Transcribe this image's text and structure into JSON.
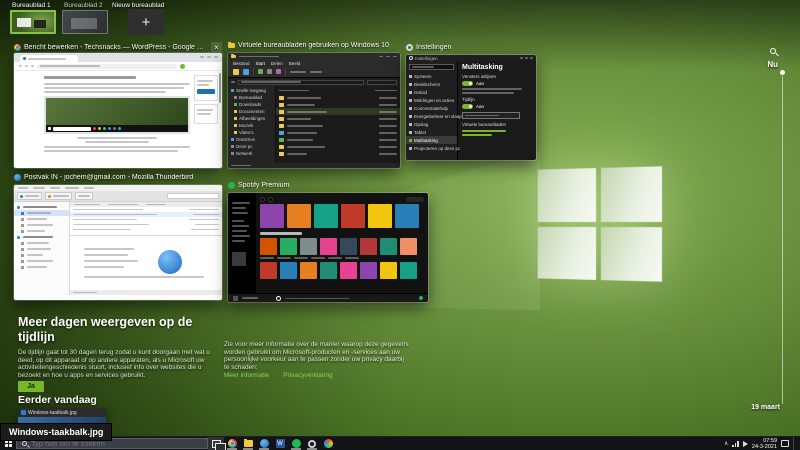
{
  "accent": {
    "green": "#76b82a",
    "link_green": "#8bd34f"
  },
  "task_view": {
    "desktops": [
      {
        "label": "Bureaublad 1"
      },
      {
        "label": "Bureaublad 2"
      }
    ],
    "new_desktop_label": "Nieuw bureaublad",
    "new_desktop_glyph": "+",
    "now_label": "Nu",
    "oldest_date_label": "19 maart"
  },
  "windows": {
    "chrome": {
      "title": "Bericht bewerken - Techsnacks — WordPress - Google Chrome",
      "close_glyph": "×"
    },
    "explorer": {
      "title": "Virtuele bureaubladen gebruiken op Windows 10",
      "tabs": [
        "Bestand",
        "Start",
        "Delen",
        "Beeld"
      ],
      "nav": [
        "Snelle toegang",
        "Bureaublad",
        "Downloads",
        "Documenten",
        "Afbeeldingen",
        "Muziek",
        "Video's",
        "OneDrive",
        "Deze pc",
        "Netwerk"
      ]
    },
    "settings": {
      "title": "Instellingen",
      "nav": [
        "Systeem",
        "Beeldscherm",
        "Geluid",
        "Meldingen en acties",
        "Concentratiehulp",
        "Energiebeheer en slaapstand",
        "Opslag",
        "Tablet",
        "Multitasking",
        "Projecteren op deze pc"
      ],
      "panel_title": "Multitasking",
      "sections": [
        "Vensters uitlijnen",
        "Tijdlijn",
        "Virtuele bureaubladen"
      ],
      "toggle_on": "Aan"
    },
    "thunderbird": {
      "title": "Postvak IN - jochem@gmail.com - Mozilla Thunderbird"
    },
    "spotify": {
      "title": "Spotify Premium"
    }
  },
  "timeline": {
    "heading": "Meer dagen weergeven op de tijdlijn",
    "paragraph_left": "De tijdlijn gaat tot 30 dagen terug zodat u kunt doorgaan met wat u deed, op dit apparaat of op andere apparaten, als u Microsoft uw activiteitengeschiedenis stuurt, inclusief info over websites die u bezoekt en hoe u apps en services gebruikt.",
    "paragraph_right": "Zie voor meer informatie over de manier waarop deze gegevens worden gebruikt om Microsoft-producten en -services aan uw persoonlijke voorkeur aan te passen zonder uw privacy daarbij te schaden:",
    "link_more": "Meer informatie",
    "link_privacy": "Privacyverklaring",
    "enable_button": "Ja",
    "earlier_heading": "Eerder vandaag",
    "card_tooltip": "Windows-taakbalk.jpg"
  },
  "taskbar": {
    "search_placeholder": "Typ hier om te zoeken",
    "clock_time": "07:59",
    "clock_date": "24-3-2021",
    "icons": [
      "start",
      "search",
      "task-view",
      "chrome",
      "file-explorer",
      "thunderbird",
      "word",
      "spotify",
      "settings",
      "paint"
    ]
  }
}
